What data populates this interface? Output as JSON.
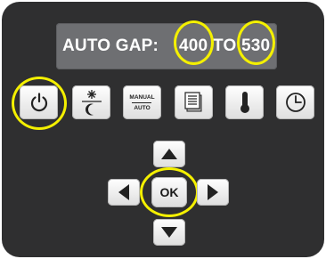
{
  "display": {
    "label": "AUTO GAP:",
    "from_value": "400",
    "to_label": "TO",
    "to_value": "530"
  },
  "keys": {
    "manual_line1": "MANUAL",
    "manual_line2": "AUTO",
    "ok_label": "OK"
  },
  "icons": [
    "power-icon",
    "day-night-icon",
    "manual-auto-icon",
    "menu-list-icon",
    "thermometer-icon",
    "clock-icon",
    "arrow-up-icon",
    "arrow-left-icon",
    "arrow-right-icon",
    "arrow-down-icon"
  ],
  "colors": {
    "panel": "#2f2f30",
    "lcd": "#6e6f72",
    "highlight": "#f4f000",
    "key": "#f2f2f2"
  }
}
